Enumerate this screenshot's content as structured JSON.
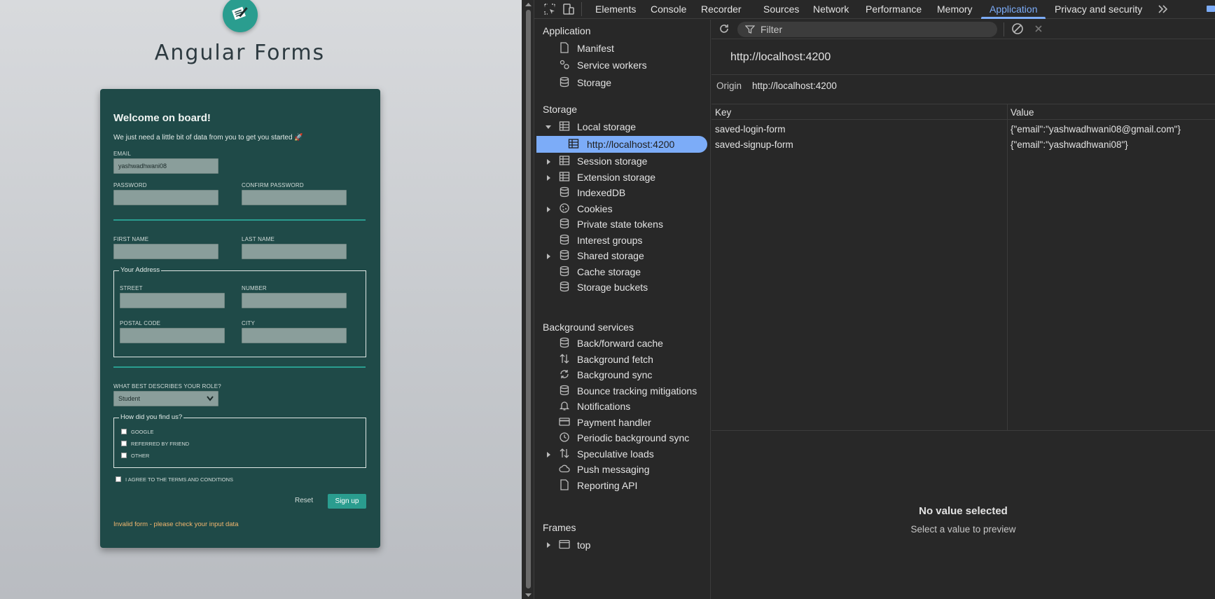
{
  "page": {
    "app_title": "Angular Forms",
    "form": {
      "heading": "Welcome on board!",
      "subheading": "We just need a little bit of data from you to get you started 🚀",
      "email_label": "EMAIL",
      "email_value": "yashwadhwani08",
      "password_label": "PASSWORD",
      "confirm_password_label": "CONFIRM PASSWORD",
      "first_name_label": "FIRST NAME",
      "last_name_label": "LAST NAME",
      "address_legend": "Your Address",
      "street_label": "STREET",
      "number_label": "NUMBER",
      "postal_code_label": "POSTAL CODE",
      "city_label": "CITY",
      "role_label": "WHAT BEST DESCRIBES YOUR ROLE?",
      "role_value": "Student",
      "source_legend": "How did you find us?",
      "source_options": [
        "GOOGLE",
        "REFERRED BY FRIEND",
        "OTHER"
      ],
      "terms_label": "I AGREE TO THE TERMS AND CONDITIONS",
      "reset_label": "Reset",
      "signup_label": "Sign up",
      "error_text": "Invalid form - please check your input data"
    }
  },
  "devtools": {
    "tabs": [
      "Elements",
      "Console",
      "Recorder",
      "Sources",
      "Network",
      "Performance",
      "Memory",
      "Application",
      "Privacy and security"
    ],
    "active_tab": "Application",
    "sidebar": {
      "application_header": "Application",
      "application_items": [
        "Manifest",
        "Service workers",
        "Storage"
      ],
      "storage_header": "Storage",
      "local_storage": "Local storage",
      "local_storage_child": "http://localhost:4200",
      "storage_items": [
        "Session storage",
        "Extension storage",
        "IndexedDB",
        "Cookies",
        "Private state tokens",
        "Interest groups",
        "Shared storage",
        "Cache storage",
        "Storage buckets"
      ],
      "background_header": "Background services",
      "background_items": [
        "Back/forward cache",
        "Background fetch",
        "Background sync",
        "Bounce tracking mitigations",
        "Notifications",
        "Payment handler",
        "Periodic background sync",
        "Speculative loads",
        "Push messaging",
        "Reporting API"
      ],
      "frames_header": "Frames",
      "frames_item": "top"
    },
    "main": {
      "filter_placeholder": "Filter",
      "origin_title": "http://localhost:4200",
      "origin_label": "Origin",
      "origin_value": "http://localhost:4200",
      "columns": [
        "Key",
        "Value"
      ],
      "rows": [
        {
          "key": "saved-login-form",
          "value": "{\"email\":\"yashwadhwani08@gmail.com\"}"
        },
        {
          "key": "saved-signup-form",
          "value": "{\"email\":\"yashwadhwani08\"}"
        }
      ],
      "empty_title": "No value selected",
      "empty_sub": "Select a value to preview"
    }
  }
}
